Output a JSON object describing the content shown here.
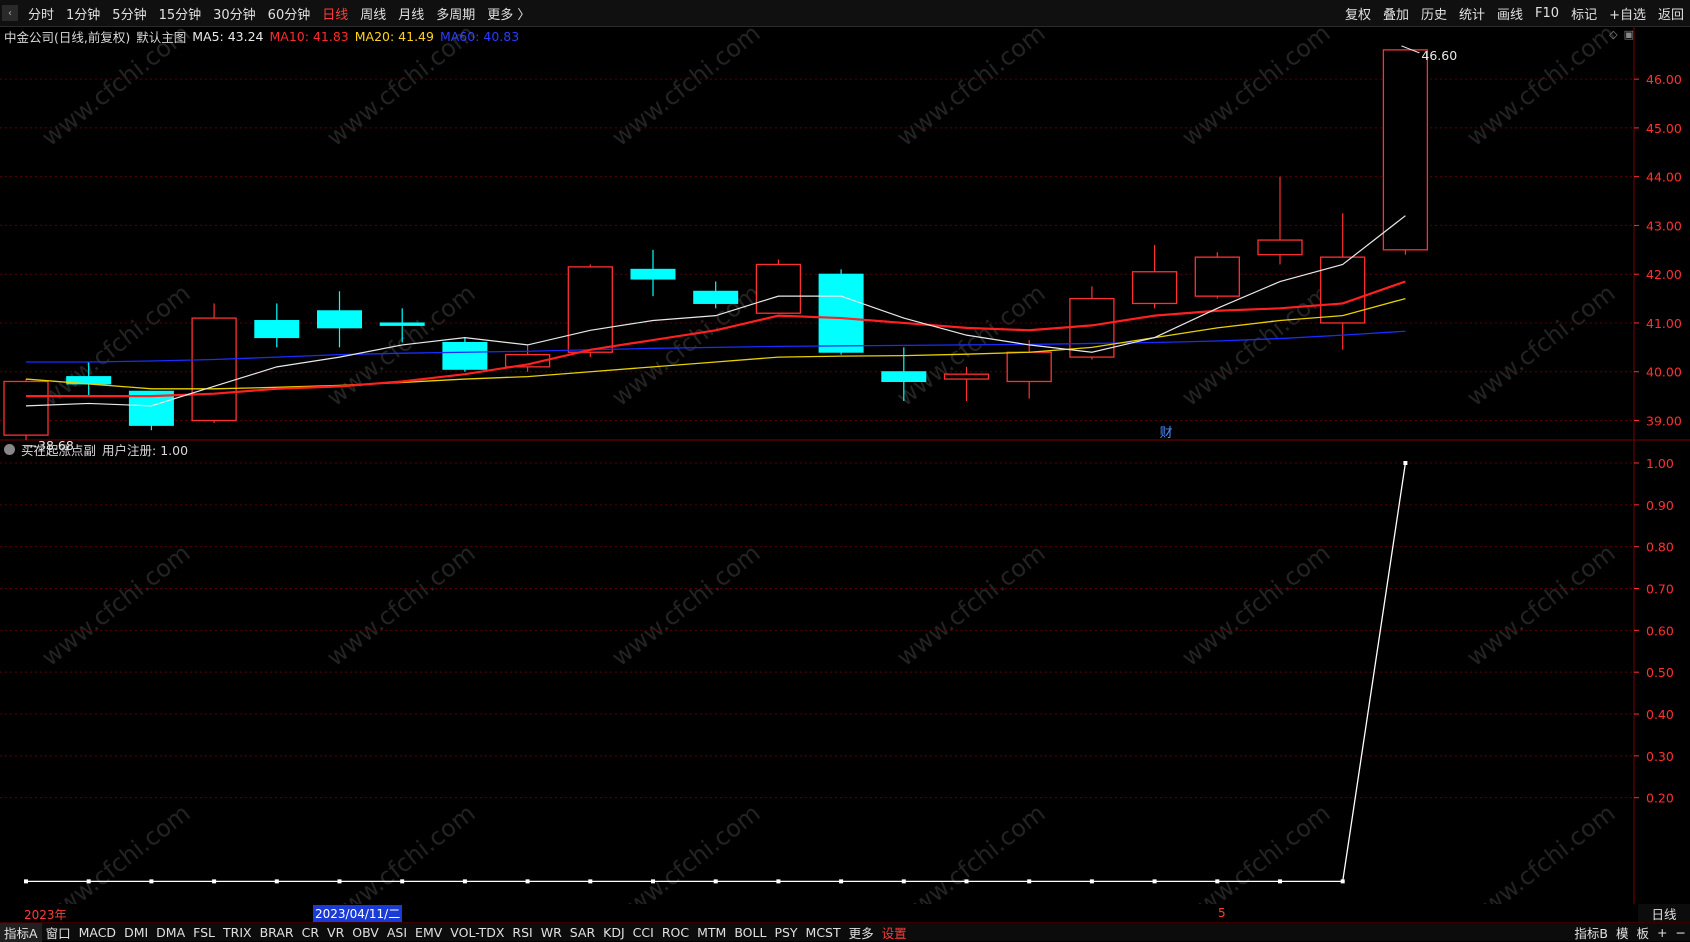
{
  "toolbar": {
    "back_icon": "chevron-left-icon",
    "periods": [
      "分时",
      "1分钟",
      "5分钟",
      "15分钟",
      "30分钟",
      "60分钟",
      "日线",
      "周线",
      "月线",
      "多周期",
      "更多 〉"
    ],
    "active_period": "日线",
    "right_items": [
      "复权",
      "叠加",
      "历史",
      "统计",
      "画线",
      "F10",
      "标记",
      "+自选",
      "返回"
    ]
  },
  "main_panel": {
    "stock_title": "中金公司(日线,前复权)",
    "template_label": "默认主图",
    "ma5": "MA5: 43.24",
    "ma10": "MA10: 41.83",
    "ma20": "MA20: 41.49",
    "ma60": "MA60: 40.83",
    "high_label": "46.60",
    "low_label": "38.68",
    "finance_marker": "财",
    "y_ticks": [
      "46.00",
      "45.00",
      "44.00",
      "43.00",
      "42.00",
      "41.00",
      "40.00",
      "39.00"
    ]
  },
  "sub_panel": {
    "title": "买在起涨点副",
    "user_label": "用户注册: 1.00",
    "y_ticks": [
      "1.00",
      "0.90",
      "0.80",
      "0.70",
      "0.60",
      "0.50",
      "0.40",
      "0.30",
      "0.20"
    ]
  },
  "date_axis": {
    "start": "2023年",
    "cursor": "2023/04/11/二",
    "mark": "5"
  },
  "period_tab": "日线",
  "bottom_bar": {
    "left_items": [
      "指标A",
      "窗口",
      "MACD",
      "DMI",
      "DMA",
      "FSL",
      "TRIX",
      "BRAR",
      "CR",
      "VR",
      "OBV",
      "ASI",
      "EMV",
      "VOL-TDX",
      "RSI",
      "WR",
      "SAR",
      "KDJ",
      "CCI",
      "ROC",
      "MTM",
      "BOLL",
      "PSY",
      "MCST",
      "更多",
      "设置"
    ],
    "right_items": [
      "指标B",
      "模",
      "板",
      "+",
      "−"
    ]
  },
  "watermark": "www.cfchi.com",
  "colors": {
    "up": "#ff3030",
    "down": "#00ffff",
    "ma5": "#e8e8e8",
    "ma10": "#ff2020",
    "ma20": "#e8d000",
    "ma60": "#1a2cff",
    "grid": "#5a0000",
    "axis_text": "#ff3030"
  },
  "chart_data": {
    "type": "candlestick",
    "price_range": [
      38.6,
      46.7
    ],
    "candles": [
      {
        "o": 38.7,
        "c": 39.8,
        "h": 39.85,
        "l": 38.6
      },
      {
        "o": 39.9,
        "c": 39.75,
        "h": 40.2,
        "l": 39.5
      },
      {
        "o": 39.6,
        "c": 38.9,
        "h": 39.6,
        "l": 38.8
      },
      {
        "o": 39.0,
        "c": 41.1,
        "h": 41.4,
        "l": 38.95
      },
      {
        "o": 41.05,
        "c": 40.7,
        "h": 41.4,
        "l": 40.5
      },
      {
        "o": 41.25,
        "c": 40.9,
        "h": 41.65,
        "l": 40.5
      },
      {
        "o": 41.0,
        "c": 40.95,
        "h": 41.3,
        "l": 40.6
      },
      {
        "o": 40.6,
        "c": 40.05,
        "h": 40.7,
        "l": 40.0
      },
      {
        "o": 40.1,
        "c": 40.35,
        "h": 40.55,
        "l": 40.0
      },
      {
        "o": 40.4,
        "c": 42.15,
        "h": 42.2,
        "l": 40.3
      },
      {
        "o": 42.1,
        "c": 41.9,
        "h": 42.5,
        "l": 41.55
      },
      {
        "o": 41.65,
        "c": 41.4,
        "h": 41.85,
        "l": 41.3
      },
      {
        "o": 41.2,
        "c": 42.2,
        "h": 42.3,
        "l": 41.2
      },
      {
        "o": 42.0,
        "c": 40.4,
        "h": 42.1,
        "l": 40.35
      },
      {
        "o": 40.0,
        "c": 39.8,
        "h": 40.5,
        "l": 39.4
      },
      {
        "o": 39.85,
        "c": 39.95,
        "h": 40.1,
        "l": 39.4
      },
      {
        "o": 39.8,
        "c": 40.4,
        "h": 40.65,
        "l": 39.45
      },
      {
        "o": 40.3,
        "c": 41.5,
        "h": 41.75,
        "l": 40.25
      },
      {
        "o": 41.4,
        "c": 42.05,
        "h": 42.6,
        "l": 41.3
      },
      {
        "o": 41.55,
        "c": 42.35,
        "h": 42.45,
        "l": 41.5
      },
      {
        "o": 42.4,
        "c": 42.7,
        "h": 44.0,
        "l": 42.2
      },
      {
        "o": 41.0,
        "c": 42.35,
        "h": 43.25,
        "l": 40.45
      },
      {
        "o": 42.5,
        "c": 46.6,
        "h": 46.6,
        "l": 42.4
      }
    ],
    "ma5": [
      39.3,
      39.35,
      39.3,
      39.7,
      40.1,
      40.3,
      40.55,
      40.7,
      40.55,
      40.85,
      41.05,
      41.15,
      41.55,
      41.55,
      41.1,
      40.75,
      40.55,
      40.4,
      40.7,
      41.3,
      41.85,
      42.2,
      43.2
    ],
    "ma10": [
      39.5,
      39.5,
      39.5,
      39.55,
      39.65,
      39.7,
      39.8,
      39.95,
      40.15,
      40.45,
      40.65,
      40.85,
      41.15,
      41.1,
      41.0,
      40.9,
      40.85,
      40.95,
      41.15,
      41.25,
      41.3,
      41.4,
      41.85
    ],
    "ma20": [
      39.85,
      39.75,
      39.65,
      39.65,
      39.68,
      39.72,
      39.78,
      39.85,
      39.9,
      40.0,
      40.1,
      40.2,
      40.3,
      40.32,
      40.33,
      40.36,
      40.4,
      40.5,
      40.7,
      40.9,
      41.05,
      41.15,
      41.5
    ],
    "ma60": [
      40.2,
      40.2,
      40.22,
      40.25,
      40.3,
      40.35,
      40.38,
      40.4,
      40.42,
      40.45,
      40.48,
      40.5,
      40.52,
      40.53,
      40.54,
      40.55,
      40.56,
      40.58,
      40.6,
      40.63,
      40.68,
      40.75,
      40.83
    ],
    "indicator": {
      "name": "买在起涨点副",
      "range": [
        0.0,
        1.0
      ],
      "values": [
        0,
        0,
        0,
        0,
        0,
        0,
        0,
        0,
        0,
        0,
        0,
        0,
        0,
        0,
        0,
        0,
        0,
        0,
        0,
        0,
        0,
        0,
        1.0
      ]
    }
  }
}
